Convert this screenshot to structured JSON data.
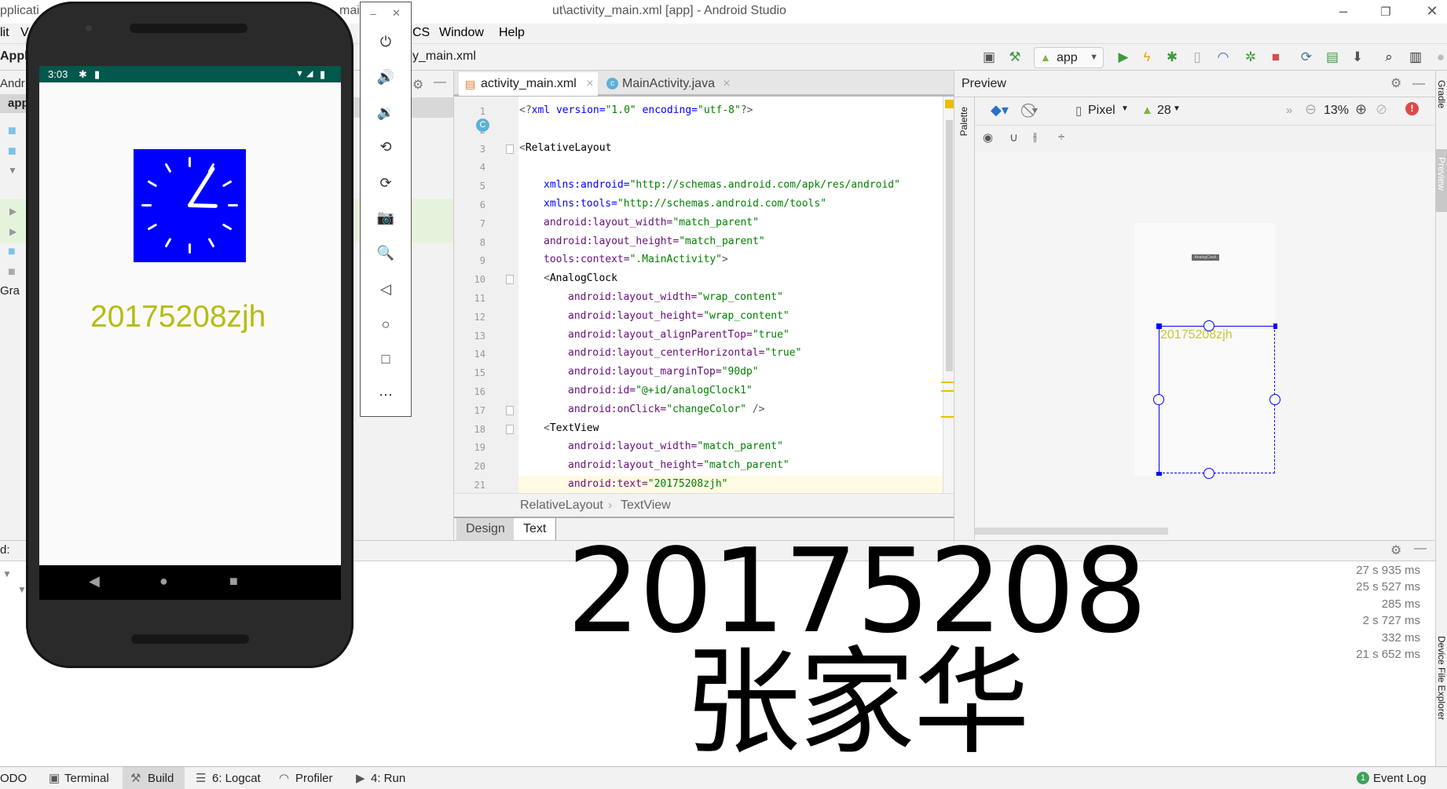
{
  "window": {
    "title_left_fragment": "pplicati",
    "title_mid_fragment": "mair",
    "title_right": "ut\\activity_main.xml [app] - Android Studio",
    "controls": [
      "minimize-icon",
      "restore-icon",
      "close-icon"
    ]
  },
  "menu": {
    "items": [
      "lit",
      "V",
      "CS",
      "Window",
      "Help"
    ]
  },
  "toolbar": {
    "breadcrumb_file": "y_main.xml",
    "run_config": "app",
    "icons": [
      "layout-editor-icon",
      "hammer-build-icon",
      "run-icon",
      "apply-changes-icon",
      "debug-icon",
      "attach-debugger-icon",
      "profile-icon",
      "debug-attach-icon",
      "stop-icon",
      "gradle-sync-icon",
      "avd-manager-icon",
      "sdk-manager-icon",
      "search-icon",
      "project-structure-icon"
    ],
    "colors": {
      "run": "#3e9b3e",
      "stop": "#db4b4b",
      "apply": "#f0a30a"
    }
  },
  "project_panel": {
    "title_fragment": "Appli",
    "view_fragment": "Andr",
    "root": "app",
    "gradle_fragment": "Gra"
  },
  "editor": {
    "tabs": [
      {
        "label": "activity_main.xml",
        "active": true,
        "icon": "xml-file-icon"
      },
      {
        "label": "MainActivity.java",
        "active": false,
        "icon": "java-class-icon"
      }
    ],
    "lines": [
      {
        "n": "1",
        "i": 0,
        "p": [
          [
            "<?",
            "br"
          ],
          [
            "xml ",
            "ns"
          ],
          [
            "version=",
            "ns"
          ],
          [
            "\"1.0\" ",
            "val"
          ],
          [
            "encoding=",
            "ns"
          ],
          [
            "\"utf-8\"",
            "val"
          ],
          [
            "?>",
            "br"
          ]
        ]
      },
      {
        "n": "2",
        "i": 0,
        "p": []
      },
      {
        "n": "3",
        "i": 0,
        "p": [
          [
            "<",
            "br"
          ],
          [
            "RelativeLayout",
            "plain"
          ]
        ]
      },
      {
        "n": "4",
        "i": 0,
        "p": []
      },
      {
        "n": "5",
        "i": 1,
        "p": [
          [
            "xmlns:android=",
            "ns"
          ],
          [
            "\"http://schemas.android.com/apk/res/android\"",
            "val"
          ]
        ]
      },
      {
        "n": "6",
        "i": 1,
        "p": [
          [
            "xmlns:tools=",
            "ns"
          ],
          [
            "\"http://schemas.android.com/tools\"",
            "val"
          ]
        ]
      },
      {
        "n": "7",
        "i": 1,
        "p": [
          [
            "android:layout_width=",
            "attr"
          ],
          [
            "\"match_parent\"",
            "val"
          ]
        ]
      },
      {
        "n": "8",
        "i": 1,
        "p": [
          [
            "android:layout_height=",
            "attr"
          ],
          [
            "\"match_parent\"",
            "val"
          ]
        ]
      },
      {
        "n": "9",
        "i": 1,
        "p": [
          [
            "tools:context=",
            "attr"
          ],
          [
            "\".MainActivity\"",
            "val"
          ],
          [
            ">",
            "br"
          ]
        ]
      },
      {
        "n": "10",
        "i": 1,
        "p": [
          [
            "<",
            "br"
          ],
          [
            "AnalogClock",
            "plain"
          ]
        ]
      },
      {
        "n": "11",
        "i": 2,
        "p": [
          [
            "android:layout_width=",
            "attr"
          ],
          [
            "\"wrap_content\"",
            "val"
          ]
        ]
      },
      {
        "n": "12",
        "i": 2,
        "p": [
          [
            "android:layout_height=",
            "attr"
          ],
          [
            "\"wrap_content\"",
            "val"
          ]
        ]
      },
      {
        "n": "13",
        "i": 2,
        "p": [
          [
            "android:layout_alignParentTop=",
            "attr"
          ],
          [
            "\"true\"",
            "val"
          ]
        ]
      },
      {
        "n": "14",
        "i": 2,
        "p": [
          [
            "android:layout_centerHorizontal=",
            "attr"
          ],
          [
            "\"true\"",
            "val"
          ]
        ]
      },
      {
        "n": "15",
        "i": 2,
        "p": [
          [
            "android:layout_marginTop=",
            "attr"
          ],
          [
            "\"90dp\"",
            "val"
          ]
        ]
      },
      {
        "n": "16",
        "i": 2,
        "p": [
          [
            "android:id=",
            "attr"
          ],
          [
            "\"@+id/analogClock1\"",
            "val"
          ]
        ]
      },
      {
        "n": "17",
        "i": 2,
        "p": [
          [
            "android:onClick=",
            "attr"
          ],
          [
            "\"changeColor\"",
            "val"
          ],
          [
            " />",
            "br"
          ]
        ]
      },
      {
        "n": "18",
        "i": 1,
        "p": [
          [
            "<",
            "br"
          ],
          [
            "TextView",
            "plain"
          ]
        ]
      },
      {
        "n": "19",
        "i": 2,
        "p": [
          [
            "android:layout_width=",
            "attr"
          ],
          [
            "\"match_parent\"",
            "val"
          ]
        ]
      },
      {
        "n": "20",
        "i": 2,
        "p": [
          [
            "android:layout_height=",
            "attr"
          ],
          [
            "\"match_parent\"",
            "val"
          ]
        ]
      },
      {
        "n": "21",
        "i": 2,
        "p": [
          [
            "android:text=",
            "attr"
          ],
          [
            "\"20175208zjh\"",
            "val"
          ]
        ]
      }
    ],
    "breadcrumbs": [
      "RelativeLayout",
      "TextView"
    ],
    "mode_tabs": [
      {
        "label": "Design",
        "active": false
      },
      {
        "label": "Text",
        "active": true
      }
    ]
  },
  "preview": {
    "title": "Preview",
    "device": "Pixel",
    "api": "28",
    "zoom": "13%",
    "palette_label": "Palette",
    "clock_label": "AnalogClock",
    "textview_text": "20175208zjh",
    "selection_color": "#0000ff",
    "text_color": "#c8c832"
  },
  "bottom_panel": {
    "title_fragment": "d:",
    "timings": [
      "27 s 935 ms",
      "25 s 527 ms",
      "285 ms",
      "2 s 727 ms",
      "332 ms",
      "21 s 652 ms"
    ]
  },
  "statusbar": {
    "items": [
      {
        "label": "ODO",
        "icon": ""
      },
      {
        "label": "Terminal",
        "icon": "terminal-icon"
      },
      {
        "label": "Build",
        "icon": "hammer-icon",
        "active": true
      },
      {
        "label": "6: Logcat",
        "icon": "logcat-icon"
      },
      {
        "label": "Profiler",
        "icon": "profiler-icon"
      },
      {
        "label": "4: Run",
        "icon": "run-icon"
      }
    ],
    "event_log": "Event Log",
    "event_count": "1"
  },
  "right_strip": {
    "items": [
      "Gradle",
      "Preview",
      "Device File Explorer"
    ]
  },
  "emulator": {
    "status_time": "3:03",
    "app_text": "20175208zjh",
    "clock_background": "#0000ff",
    "text_color": "#b5bd12",
    "status_bar_color": "#00574b",
    "clock_time": "3:03",
    "toolbar_icons": [
      "power-icon",
      "volume-up-icon",
      "volume-down-icon",
      "rotate-left-icon",
      "rotate-right-icon",
      "camera-icon",
      "zoom-icon",
      "back-icon",
      "home-icon",
      "overview-icon",
      "more-icon"
    ],
    "toolbar_glyphs": [
      "⏻",
      "🔊",
      "🔉",
      "⟲",
      "⟳",
      "📷",
      "🔍",
      "◁",
      "○",
      "□",
      "⋯"
    ]
  },
  "annotation": {
    "handwriting": "20175208 张家华"
  }
}
